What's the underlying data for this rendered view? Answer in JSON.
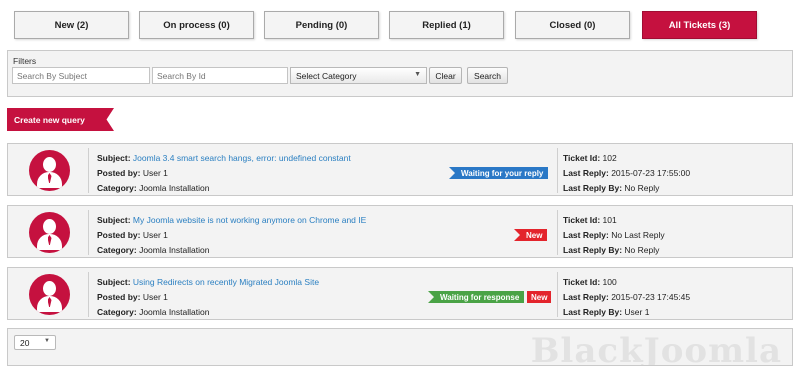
{
  "tabs": [
    {
      "label": "New (2)",
      "active": false
    },
    {
      "label": "On process (0)",
      "active": false
    },
    {
      "label": "Pending (0)",
      "active": false
    },
    {
      "label": "Replied (1)",
      "active": false
    },
    {
      "label": "Closed (0)",
      "active": false
    },
    {
      "label": "All Tickets (3)",
      "active": true
    }
  ],
  "filters": {
    "title": "Filters",
    "subject_placeholder": "Search By Subject",
    "id_placeholder": "Search By Id",
    "category_selected": "Select Category",
    "clear_label": "Clear",
    "search_label": "Search"
  },
  "create_label": "Create new query",
  "labels": {
    "subject": "Subject:",
    "posted_by": "Posted by:",
    "category": "Category:",
    "ticket_id": "Ticket Id:",
    "last_reply": "Last Reply:",
    "last_reply_by": "Last Reply By:"
  },
  "tickets": [
    {
      "subject": "Joomla 3.4 smart search hangs, error: undefined constant",
      "posted_by": "User 1",
      "category": "Joomla Installation",
      "status": "Waiting for your reply",
      "status_extra": "",
      "ticket_id": "102",
      "last_reply": "2015-07-23 17:55:00",
      "last_reply_by": "No Reply"
    },
    {
      "subject": "My Joomla website is not working anymore on Chrome and IE",
      "posted_by": "User 1",
      "category": "Joomla Installation",
      "status": "New",
      "status_extra": "",
      "ticket_id": "101",
      "last_reply": "No Last Reply",
      "last_reply_by": "No Reply"
    },
    {
      "subject": "Using Redirects on recently Migrated Joomla Site",
      "posted_by": "User 1",
      "category": "Joomla Installation",
      "status": "Waiting for response",
      "status_extra": "New",
      "ticket_id": "100",
      "last_reply": "2015-07-23 17:45:45",
      "last_reply_by": "User 1"
    }
  ],
  "pagination": {
    "limit": "20"
  },
  "watermark": "BlackJoomla",
  "colors": {
    "accent": "#c5113f",
    "link": "#2a7fc1",
    "badge_blue": "#2a78c6",
    "badge_red": "#e3242c",
    "badge_green": "#4aa346"
  },
  "icons": {
    "avatar": "user-avatar-icon",
    "select": "chevron-down-icon"
  }
}
